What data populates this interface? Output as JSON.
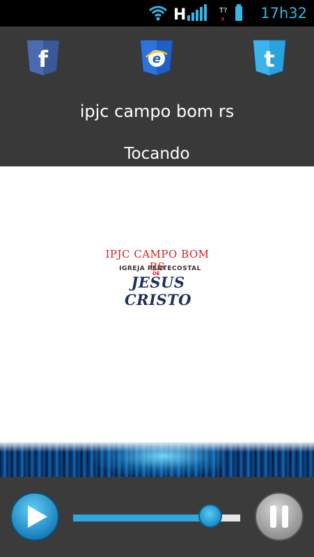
{
  "status_bar": {
    "time": "17h32",
    "network_label": "H",
    "icons": [
      "wifi-icon",
      "signal-icon",
      "sim-missing-icon",
      "battery-icon"
    ]
  },
  "social": {
    "facebook_label": "f",
    "browser_label": "e",
    "twitter_label": "t"
  },
  "station": {
    "title": "ipjc campo bom rs",
    "status": "Tocando"
  },
  "logo": {
    "line1": "IPJC CAMPO BOM RS",
    "line2": "IGREJA PENTECOSTAL",
    "de": "DE",
    "line3": "JESUS CRISTO"
  },
  "player": {
    "progress": 0.82,
    "play_icon": "play-icon",
    "pause_icon": "pause-icon"
  },
  "colors": {
    "accent": "#2fa8dd",
    "background": "#393939",
    "facebook": "#3b5998",
    "twitter": "#29a3e0",
    "browser": "#1f5fc6"
  }
}
